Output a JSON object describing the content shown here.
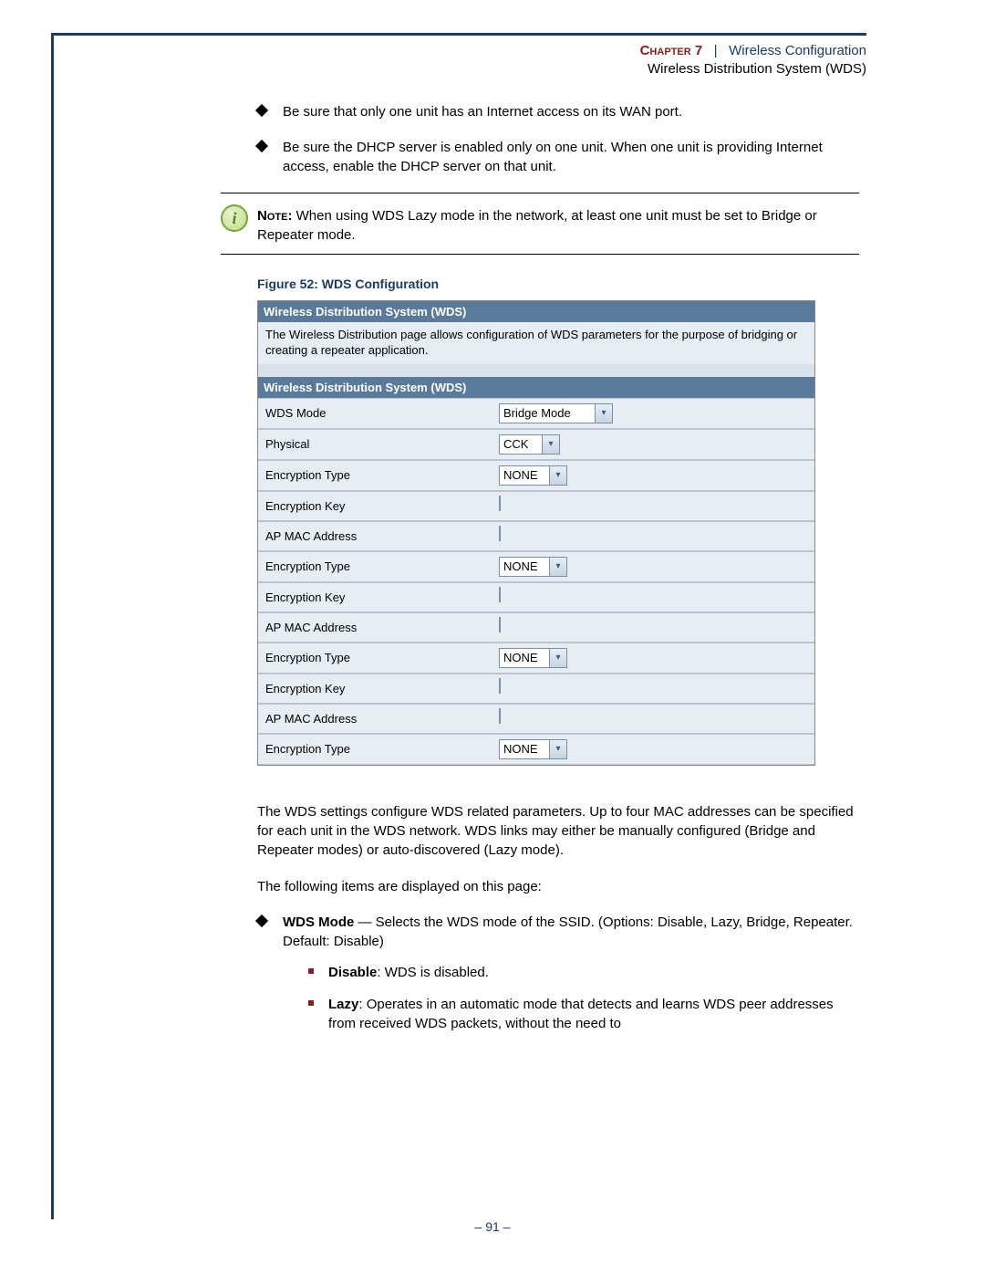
{
  "header": {
    "chapter_label": "Chapter 7",
    "section_title": "Wireless Configuration",
    "subsection_title": "Wireless Distribution System (WDS)"
  },
  "bullets": {
    "b1": "Be sure that only one unit has an Internet access on its WAN port.",
    "b2": "Be sure the DHCP server is enabled only on one unit. When one unit is providing Internet access, enable the DHCP server on that unit."
  },
  "note": {
    "label": "Note:",
    "text": " When using WDS Lazy mode in the network, at least one unit must be set to Bridge or Repeater mode."
  },
  "figure": {
    "caption": "Figure 52:  WDS Configuration"
  },
  "screenshot": {
    "panel1_title": "Wireless Distribution System (WDS)",
    "panel1_desc": "The Wireless Distribution page allows configuration of WDS parameters for the purpose of bridging or creating a repeater application.",
    "panel2_title": "Wireless Distribution System (WDS)",
    "rows": {
      "wds_mode_label": "WDS Mode",
      "wds_mode_value": "Bridge Mode",
      "physical_label": "Physical",
      "physical_value": "CCK",
      "enc_type_label": "Encryption Type",
      "enc_type_value": "NONE",
      "enc_key_label": "Encryption Key",
      "ap_mac_label": "AP MAC Address"
    }
  },
  "body": {
    "p1": "The WDS settings configure WDS related parameters. Up to four MAC addresses can be specified for each unit in the WDS network. WDS links may either be manually configured (Bridge and Repeater modes) or auto-discovered (Lazy mode).",
    "p2": "The following items are displayed on this page:",
    "wds_mode_term": "WDS Mode",
    "wds_mode_desc": " — Selects the WDS mode of the SSID. (Options: Disable, Lazy, Bridge, Repeater. Default: Disable)",
    "disable_term": "Disable",
    "disable_desc": ": WDS is disabled.",
    "lazy_term": "Lazy",
    "lazy_desc": ": Operates in an automatic mode that detects and learns WDS peer addresses from received WDS packets, without the need to"
  },
  "footer": {
    "page": "–  91  –"
  }
}
